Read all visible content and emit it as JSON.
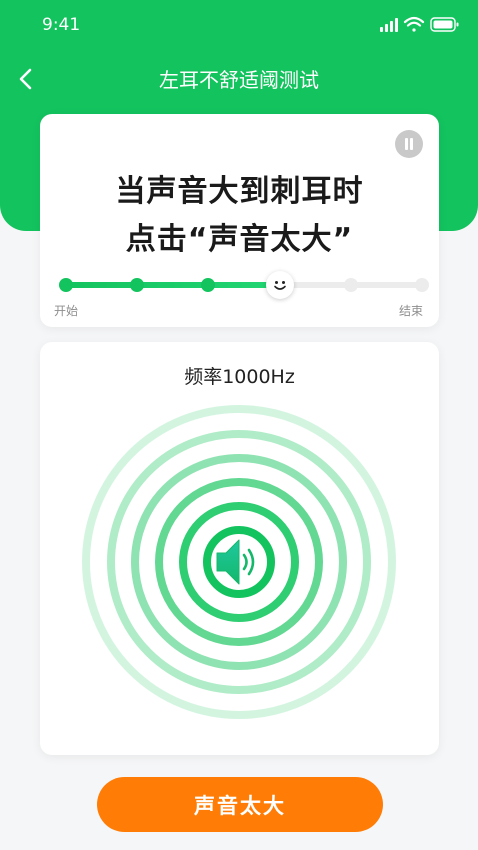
{
  "status_bar": {
    "time": "9:41"
  },
  "nav": {
    "title": "左耳不舒适阈测试"
  },
  "instruction": {
    "line1": "当声音大到刺耳时",
    "line2": "点击“声音太大”"
  },
  "progress": {
    "start_label": "开始",
    "end_label": "结束",
    "total_steps": 6,
    "current_step": 4
  },
  "test": {
    "frequency_label": "频率1000Hz"
  },
  "action": {
    "button_label": "声音太大"
  },
  "colors": {
    "primary_green": "#13c35e",
    "action_orange": "#ff7d07",
    "ring_light": "#d3f5e0"
  }
}
